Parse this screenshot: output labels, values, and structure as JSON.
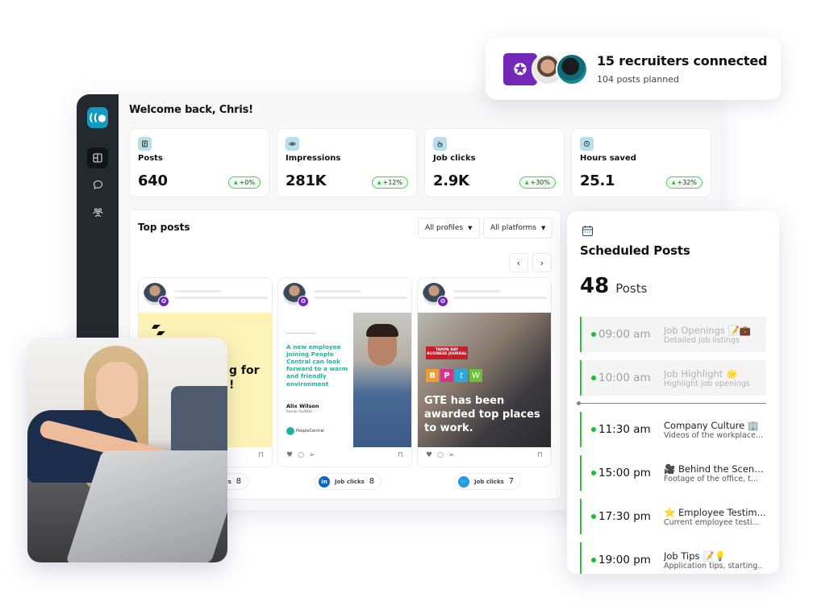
{
  "recruiters": {
    "title": "15 recruiters connected",
    "subtitle": "104 posts planned"
  },
  "dashboard": {
    "welcome": "Welcome back, Chris!",
    "sidebar": {
      "items": [
        {
          "icon": "layout-icon",
          "active": true
        },
        {
          "icon": "chat-icon",
          "active": false
        },
        {
          "icon": "users-icon",
          "active": false
        }
      ]
    },
    "stats": [
      {
        "label": "Posts",
        "value": "640",
        "change": "+0%",
        "icon": "document-icon"
      },
      {
        "label": "Impressions",
        "value": "281K",
        "change": "+12%",
        "icon": "eye-icon"
      },
      {
        "label": "Job clicks",
        "value": "2.9K",
        "change": "+30%",
        "icon": "pointer-icon"
      },
      {
        "label": "Hours saved",
        "value": "25.1",
        "change": "+32%",
        "icon": "clock-icon"
      }
    ],
    "top_posts": {
      "title": "Top posts",
      "profile_filter": "All profiles",
      "platform_filter": "All platforms",
      "posts": [
        {
          "headline_fragment": "g for",
          "headline_fragment2": "!",
          "platform": "",
          "job_clicks_label": "Job clicks",
          "job_clicks": "8"
        },
        {
          "quote": "A new employee joining People Central can look forward to a warm and friendly environment",
          "author": "Alix Wilson",
          "role": "Senior Auditor",
          "brand": "PeopleCentral",
          "platform": "linkedin",
          "job_clicks_label": "Job clicks",
          "job_clicks": "8"
        },
        {
          "source": "TAMPA BAY BUSINESS JOURNAL",
          "badges": [
            "B",
            "P",
            "t",
            "W"
          ],
          "headline": "GTE has been awarded top places to work.",
          "platform": "twitter",
          "job_clicks_label": "Job clicks",
          "job_clicks": "7"
        }
      ]
    }
  },
  "scheduled": {
    "title": "Scheduled Posts",
    "count": "48",
    "unit": "Posts",
    "slots": [
      {
        "time": "09:00 am",
        "title": "Job Openings 📝💼",
        "desc": "Detailed job listings",
        "past": true
      },
      {
        "time": "10:00 am",
        "title": "Job Highlight 🌟",
        "desc": "Highlight job openings",
        "past": true
      },
      {
        "time": "11:30 am",
        "title": "Company Culture 🏢",
        "desc": "Videos of the workplace...",
        "past": false
      },
      {
        "time": "15:00 pm",
        "title": "🎥 Behind the Scenes..",
        "desc": "Footage of the office, t...",
        "past": false
      },
      {
        "time": "17:30 pm",
        "title": "⭐ Employee Testim...",
        "desc": "Current employee testi...",
        "past": false
      },
      {
        "time": "19:00 pm",
        "title": "Job Tips 📝💡",
        "desc": "Application tips, starting..",
        "past": false
      }
    ]
  },
  "colors": {
    "accent_teal": "#139ac0",
    "brand_purple": "#7428b8",
    "status_green": "#2fc13a",
    "sidebar_dark": "#24282f"
  }
}
